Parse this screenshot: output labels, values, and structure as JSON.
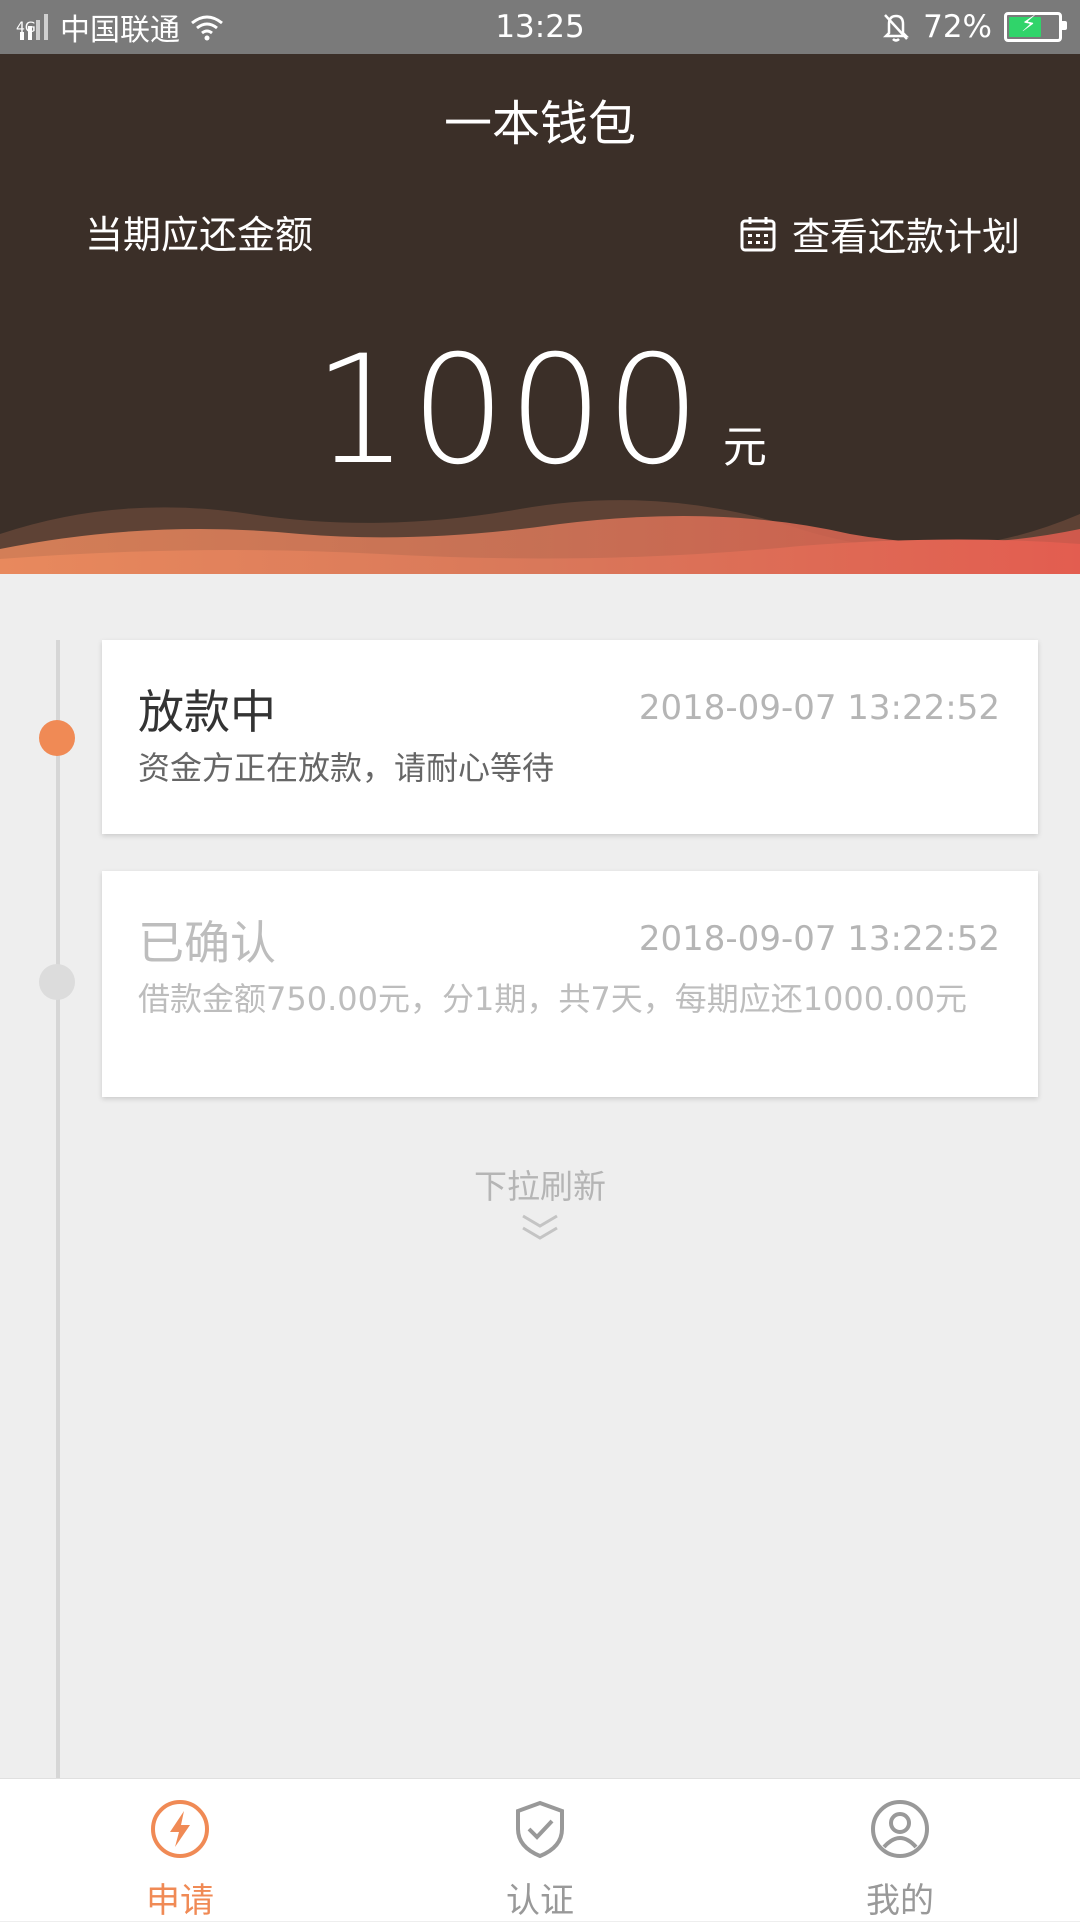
{
  "status_bar": {
    "network": "4G",
    "carrier": "中国联通",
    "time": "13:25",
    "battery": "72%",
    "battery_level": 0.72
  },
  "header": {
    "title": "一本钱包",
    "due_label": "当期应还金额",
    "plan_link": "查看还款计划",
    "amount": "1000",
    "unit": "元"
  },
  "timeline": [
    {
      "title": "放款中",
      "time": "2018-09-07 13:22:52",
      "desc": "资金方正在放款，请耐心等待",
      "active": true
    },
    {
      "title": "已确认",
      "time": "2018-09-07 13:22:52",
      "desc": "借款金额750.00元，分1期，共7天，每期应还1000.00元",
      "active": false
    }
  ],
  "pull_refresh": "下拉刷新",
  "tabs": [
    {
      "label": "申请",
      "icon": "lightning-icon",
      "active": true
    },
    {
      "label": "认证",
      "icon": "shield-check-icon",
      "active": false
    },
    {
      "label": "我的",
      "icon": "user-icon",
      "active": false
    }
  ],
  "colors": {
    "header_bg": "#3b2f28",
    "accent": "#f08a55",
    "status_bar_bg": "#7a7a7a"
  }
}
